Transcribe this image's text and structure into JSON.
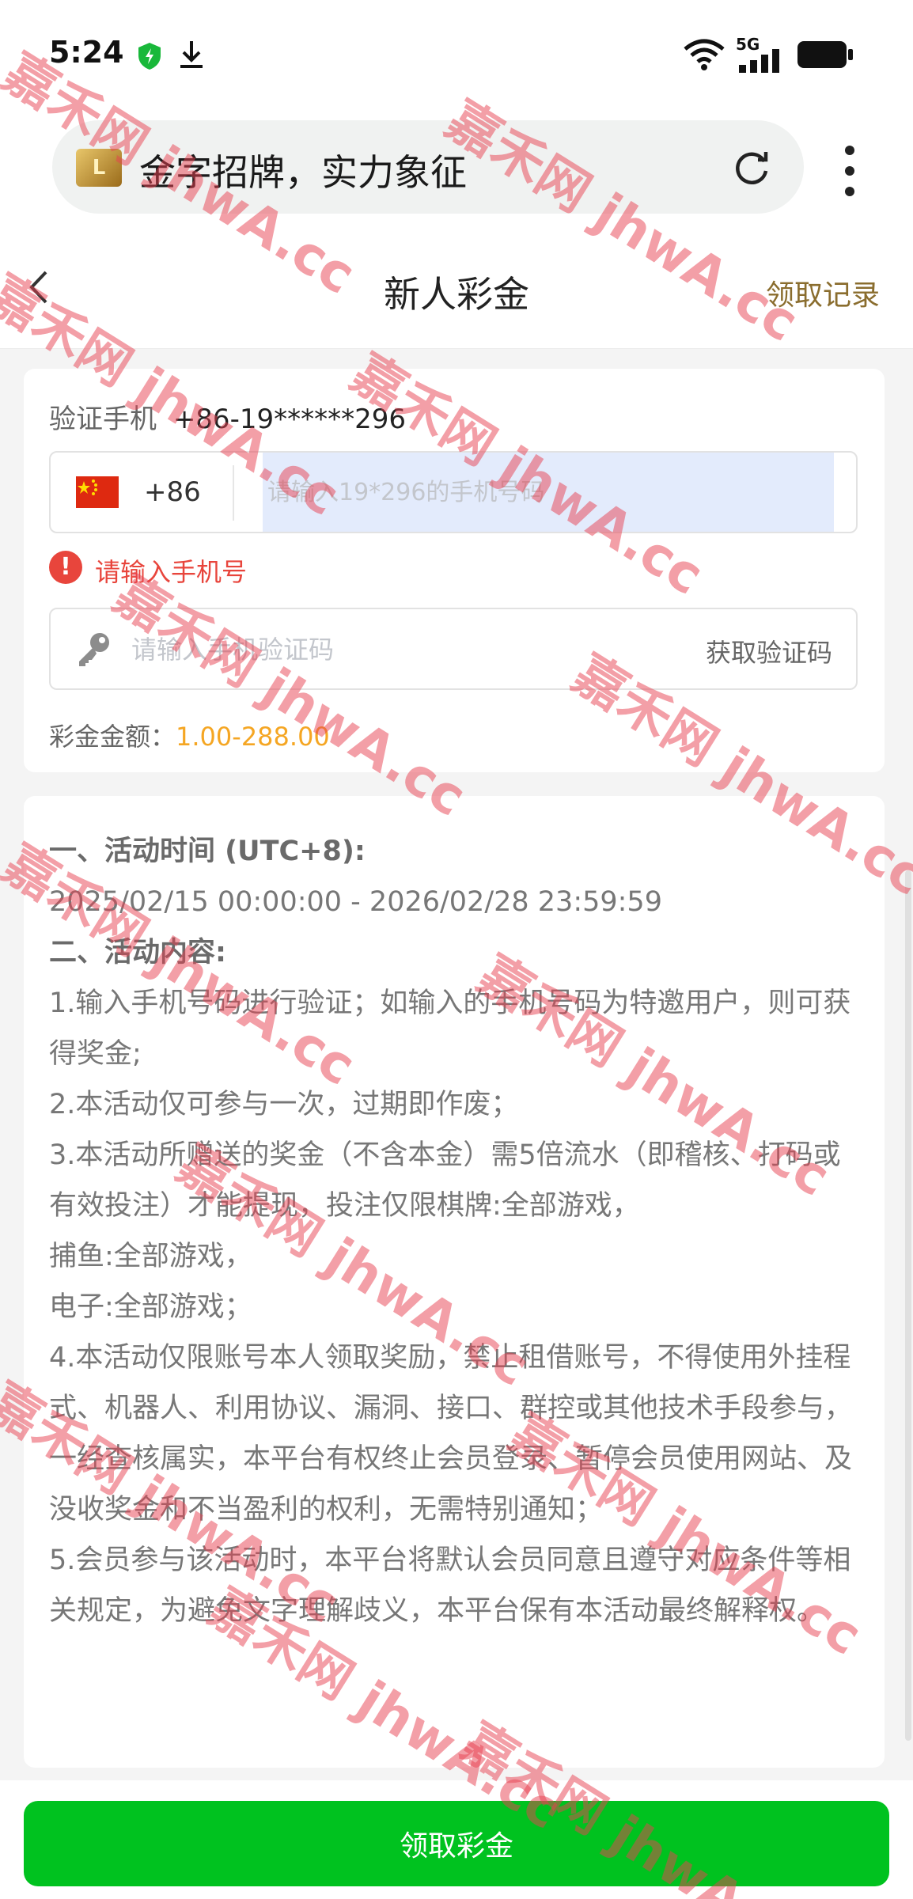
{
  "status_bar": {
    "time": "5:24",
    "network": "5G",
    "icons": [
      "shield-icon",
      "download-icon",
      "wifi-icon",
      "signal-icon",
      "battery-icon"
    ]
  },
  "browser": {
    "page_title": "金字招牌，实力象征",
    "logo_text": "L"
  },
  "header": {
    "title": "新人彩金",
    "record_link": "领取记录"
  },
  "form": {
    "verify_label": "验证手机",
    "verify_phone": "+86-19******296",
    "country_code": "+86",
    "phone_placeholder": "请输入19*296的手机号码",
    "error_text": "请输入手机号",
    "code_placeholder": "请输入手机验证码",
    "get_code_label": "获取验证码",
    "amount_label": "彩金金额：",
    "amount_value": "1.00-288.00"
  },
  "rules": {
    "heading_time": "一、活动时间 (UTC+8):",
    "time_range": "2025/02/15 00:00:00 - 2026/02/28 23:59:59",
    "heading_content": "二、活动内容:",
    "item1": "1.输入手机号码进行验证；如输入的手机号码为特邀用户，则可获得奖金;",
    "item2": "2.本活动仅可参与一次，过期即作废；",
    "item3": "3.本活动所赠送的奖金（不含本金）需5倍流水（即稽核、打码或有效投注）才能提现，投注仅限棋牌:全部游戏，",
    "item3b": "捕鱼:全部游戏，",
    "item3c": "电子:全部游戏；",
    "item4": "4.本活动仅限账号本人领取奖励，禁止租借账号，不得使用外挂程式、机器人、利用协议、漏洞、接口、群控或其他技术手段参与，一经查核属实，本平台有权终止会员登录、暂停会员使用网站、及没收奖金和不当盈利的权利，无需特别通知；",
    "item5": "5.会员参与该活动时，本平台将默认会员同意且遵守对应条件等相关规定，为避免文字理解歧义，本平台保有本活动最终解释权。"
  },
  "footer": {
    "claim_label": "领取彩金"
  },
  "watermark": {
    "text": "嘉禾网 jhwA.cc"
  },
  "colors": {
    "primary_green": "#00c21f",
    "error_red": "#e8453c",
    "amount_orange": "#f5a623",
    "link_brown": "#8a6d2e",
    "input_highlight": "#e3ebfc"
  }
}
